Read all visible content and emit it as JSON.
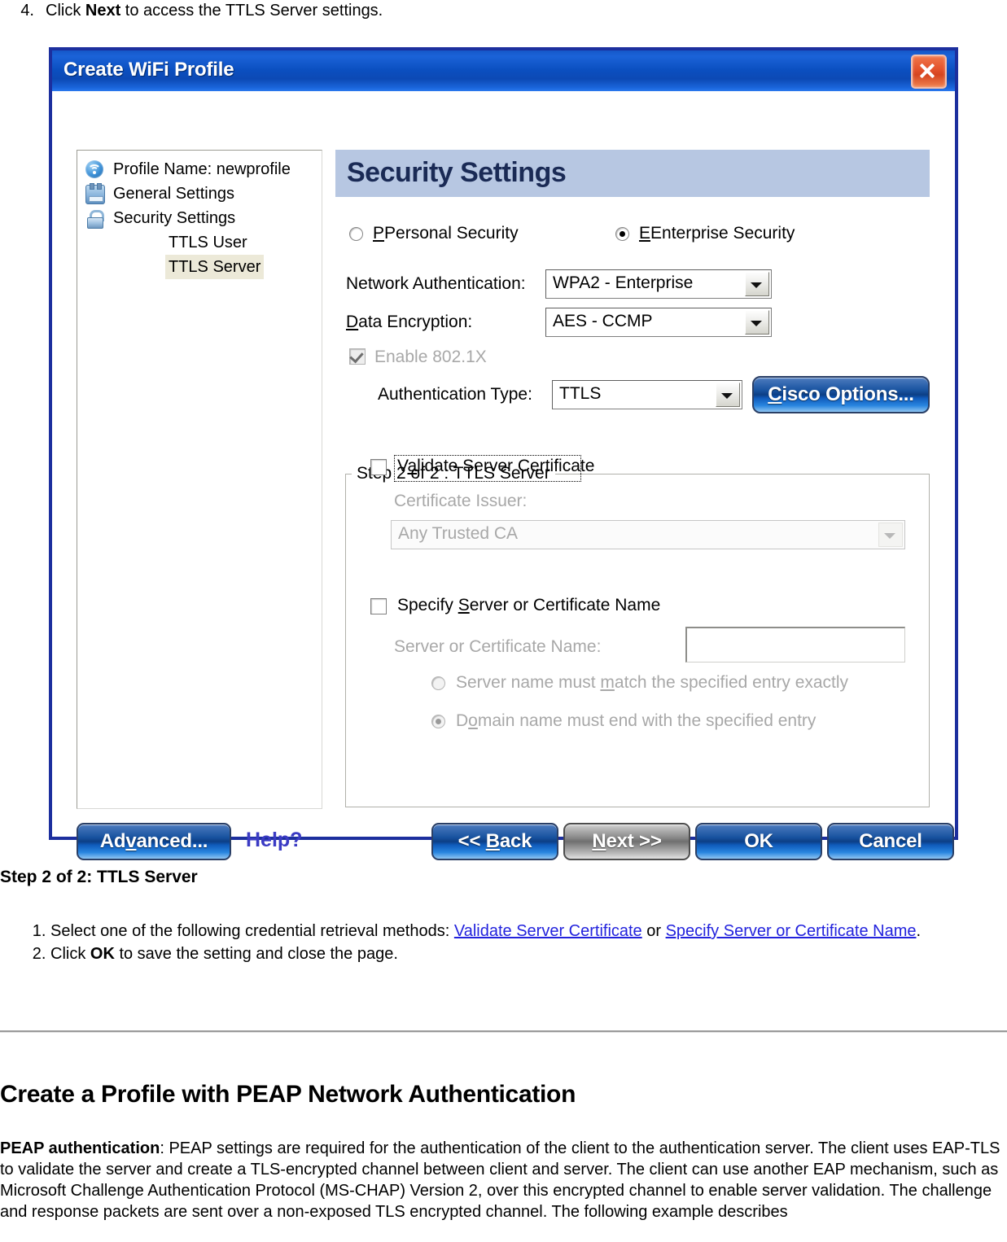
{
  "document": {
    "step4": {
      "num": "4.",
      "pre": "Click ",
      "bold": "Next",
      "post": " to access the TTLS Server settings."
    },
    "section_heading": "Step 2 of 2: TTLS Server",
    "list": {
      "item1_pre": "Select one of the following credential retrieval methods: ",
      "item1_link1": "Validate Server Certificate",
      "item1_mid": " or ",
      "item1_link2": "Specify Server or Certificate Name",
      "item1_post": ".",
      "item2_pre": "Click ",
      "item2_bold": "OK",
      "item2_post": " to save the setting and close the page."
    },
    "peap_heading": "Create a Profile with PEAP Network Authentication",
    "peap_bold": "PEAP authentication",
    "peap_text": ": PEAP settings are required for the authentication of the client to the authentication server. The client uses EAP-TLS to validate the server and create a TLS-encrypted channel between client and server. The client can use another EAP mechanism, such as Microsoft Challenge Authentication Protocol (MS-CHAP) Version 2, over this encrypted channel to enable server validation. The challenge and response packets are sent over a non-exposed TLS encrypted channel. The following example describes"
  },
  "dialog": {
    "title": "Create WiFi Profile",
    "close_label": "x",
    "tree": [
      {
        "label": "Profile Name: newprofile",
        "icon": "wifi-icon",
        "indent": 44,
        "selected": false
      },
      {
        "label": "General Settings",
        "icon": "adapter-icon",
        "indent": 44,
        "selected": false
      },
      {
        "label": "Security Settings",
        "icon": "lock-icon",
        "indent": 44,
        "selected": false
      },
      {
        "label": "TTLS User",
        "icon": "",
        "indent": 112,
        "selected": false
      },
      {
        "label": "TTLS Server",
        "icon": "",
        "indent": 112,
        "selected": true
      }
    ],
    "pane": {
      "header": "Security Settings",
      "personal_security": "Personal Security",
      "enterprise_security": "Enterprise Security",
      "selected_security_mode": "Enterprise Security",
      "network_auth_label": "Network Authentication:",
      "network_auth_value": "WPA2 - Enterprise",
      "data_encryption_label": "Data Encryption:",
      "data_encryption_value": "AES - CCMP",
      "enable_8021x_label": "Enable 802.1X",
      "enable_8021x_checked": true,
      "auth_type_label": "Authentication Type:",
      "auth_type_value": "TTLS",
      "cisco_options": "Cisco Options...",
      "groupbox_legend": "Step 2 of 2 : TTLS Server",
      "validate_server_cert": "Validate Server Certificate",
      "validate_server_cert_checked": false,
      "cert_issuer_label": "Certificate Issuer:",
      "cert_issuer_value": "Any Trusted CA",
      "specify_server_name": "Specify Server or Certificate Name",
      "specify_server_name_checked": false,
      "server_name_label": "Server or Certificate Name:",
      "server_name_value": "",
      "radio_match_exactly": "Server name must match the specified entry exactly",
      "radio_domain_end": "Domain name must end with the specified entry",
      "selected_name_rule": "Domain name must end with the specified entry"
    },
    "buttons": {
      "advanced": "Advanced...",
      "help": "Help?",
      "back": "<< Back",
      "next": "Next >>",
      "ok": "OK",
      "cancel": "Cancel"
    }
  },
  "colors": {
    "titlebar_blue": "#0c49b4",
    "dialog_border": "#1c2f9e",
    "header_band": "#b7c7e2",
    "header_text": "#1a2a55",
    "selection": "#ece9d8",
    "link": "#2222dd",
    "close_red": "#e2502a"
  }
}
